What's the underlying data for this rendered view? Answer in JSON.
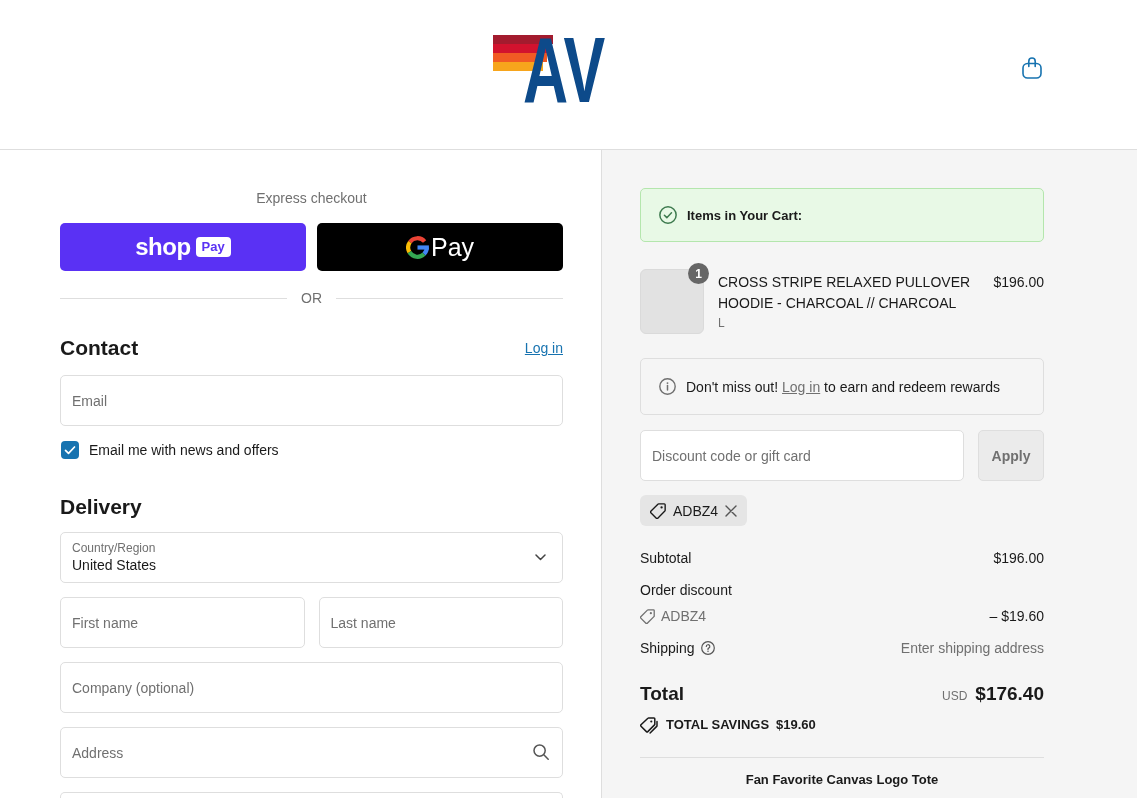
{
  "header": {
    "logo": "AV"
  },
  "express_checkout": {
    "title": "Express checkout",
    "buttons": [
      {
        "kind": "shop_pay",
        "wordmark": "shop",
        "badge": "Pay"
      },
      {
        "kind": "google_pay",
        "label": "Pay"
      }
    ],
    "separator": "OR"
  },
  "contact": {
    "heading": "Contact",
    "login_link": "Log in",
    "email": {
      "placeholder": "Email"
    },
    "newsletter": {
      "label": "Email me with news and offers",
      "checked": true
    }
  },
  "delivery": {
    "heading": "Delivery",
    "rows": [
      {
        "fields": [
          {
            "kind": "select",
            "label": "Country/Region",
            "value": "United States"
          }
        ]
      },
      {
        "fields": [
          {
            "kind": "text",
            "placeholder": "First name"
          },
          {
            "kind": "text",
            "placeholder": "Last name"
          }
        ]
      },
      {
        "fields": [
          {
            "kind": "text",
            "placeholder": "Company (optional)"
          }
        ]
      },
      {
        "fields": [
          {
            "kind": "address",
            "placeholder": "Address"
          }
        ]
      },
      {
        "fields": [
          {
            "kind": "text"
          }
        ]
      }
    ]
  },
  "order_summary": {
    "notice": {
      "title": "Items in Your Cart:"
    },
    "items": [
      {
        "title": "CROSS STRIPE RELAXED PULLOVER HOODIE - CHARCOAL // CHARCOAL",
        "variant": "L",
        "quantity": "1",
        "price": "$196.00"
      }
    ],
    "rewards": {
      "before": "Don't miss out!",
      "link": "Log in",
      "after": "to earn and redeem rewards"
    },
    "discount": {
      "placeholder": "Discount code or gift card",
      "button": {
        "label": "Apply",
        "disabled": true
      }
    },
    "applied_codes": [
      {
        "code": "ADBZ4"
      }
    ],
    "lines": [
      {
        "kind": "amount",
        "label": "Subtotal",
        "value": "$196.00"
      },
      {
        "kind": "heading",
        "label": "Order discount"
      },
      {
        "kind": "code",
        "label": "ADBZ4",
        "value": "– $19.60"
      },
      {
        "kind": "shipping",
        "label": "Shipping",
        "value": "Enter shipping address"
      }
    ],
    "total": {
      "label": "Total",
      "currency": "USD",
      "amount": "$176.40"
    },
    "savings": {
      "label": "TOTAL SAVINGS",
      "amount": "$19.60"
    },
    "upsell": {
      "title": "Fan Favorite Canvas Logo Tote"
    }
  }
}
